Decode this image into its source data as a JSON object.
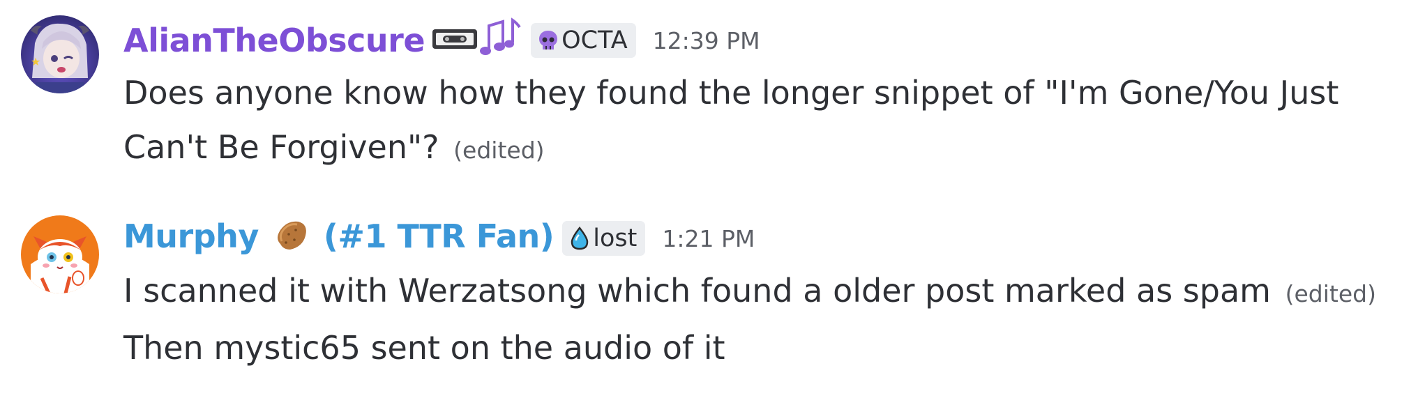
{
  "messages": [
    {
      "username": "AlianTheObscure",
      "name_emojis": [
        "videocassette-icon",
        "music-notes-icon"
      ],
      "role_tag": {
        "icon": "skull-icon",
        "label": "OCTA",
        "icon_color": "#9b6fe0"
      },
      "timestamp": "12:39 PM",
      "name_color": "#7d4fd6",
      "lines": [
        {
          "text": "Does anyone know how they found the longer snippet of \"I'm Gone/You Just",
          "edited": ""
        },
        {
          "text": "Can't Be Forgiven\"?",
          "edited": "(edited)"
        }
      ]
    },
    {
      "username_part1": "Murphy",
      "username_emoji": "potato-icon",
      "username_part2": "(#1 TTR Fan)",
      "role_tag": {
        "icon": "water-drop-icon",
        "label": "lost",
        "icon_color": "#3fb4e8"
      },
      "timestamp": "1:21 PM",
      "name_color": "#3b97d8",
      "lines": [
        {
          "text": "I scanned it with Werzatsong which found a older post marked as spam",
          "edited": "(edited)"
        },
        {
          "text": "Then mystic65 sent on the audio of it",
          "edited": ""
        }
      ]
    }
  ]
}
